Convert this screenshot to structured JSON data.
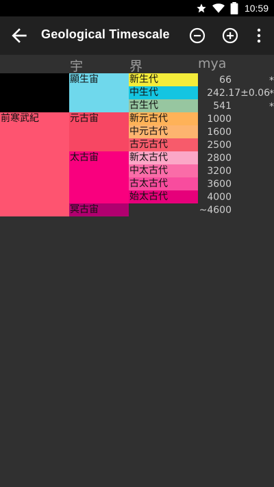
{
  "status": {
    "time": "10:59",
    "icons": [
      "star-icon",
      "wifi-icon",
      "battery-icon"
    ]
  },
  "appbar": {
    "title": "Geological Timescale"
  },
  "headers": {
    "eon": "宇",
    "era": "界",
    "mya": "mya"
  },
  "supereon": [
    {
      "label": "",
      "color": "#000000"
    },
    {
      "label": "前寒武紀",
      "color": "#FE5470"
    }
  ],
  "eons": [
    {
      "label": "顯生宙",
      "color": "#6FD8EC"
    },
    {
      "label": "元古宙",
      "color": "#F74763"
    },
    {
      "label": "太古宙",
      "color": "#F9007E"
    },
    {
      "label": "冥古宙",
      "color": "#B0006F"
    }
  ],
  "eras": [
    {
      "label": "新生代",
      "color": "#F4EC3A"
    },
    {
      "label": "中生代",
      "color": "#14C5E1"
    },
    {
      "label": "古生代",
      "color": "#97C6A0"
    },
    {
      "label": "新元古代",
      "color": "#FEB258"
    },
    {
      "label": "中元古代",
      "color": "#FDB46F"
    },
    {
      "label": "古元古代",
      "color": "#F75B6B"
    },
    {
      "label": "新太古代",
      "color": "#FBA7C7"
    },
    {
      "label": "中太古代",
      "color": "#FA6CA8"
    },
    {
      "label": "古太古代",
      "color": "#F84C9E"
    },
    {
      "label": "始太古代",
      "color": "#E6007A"
    }
  ],
  "mya_values": [
    "66",
    "242.17±0.06",
    "541",
    "1000",
    "1600",
    "2500",
    "2800",
    "3200",
    "3600",
    "4000",
    "~4600"
  ],
  "stars": [
    "*",
    "*",
    "*"
  ]
}
